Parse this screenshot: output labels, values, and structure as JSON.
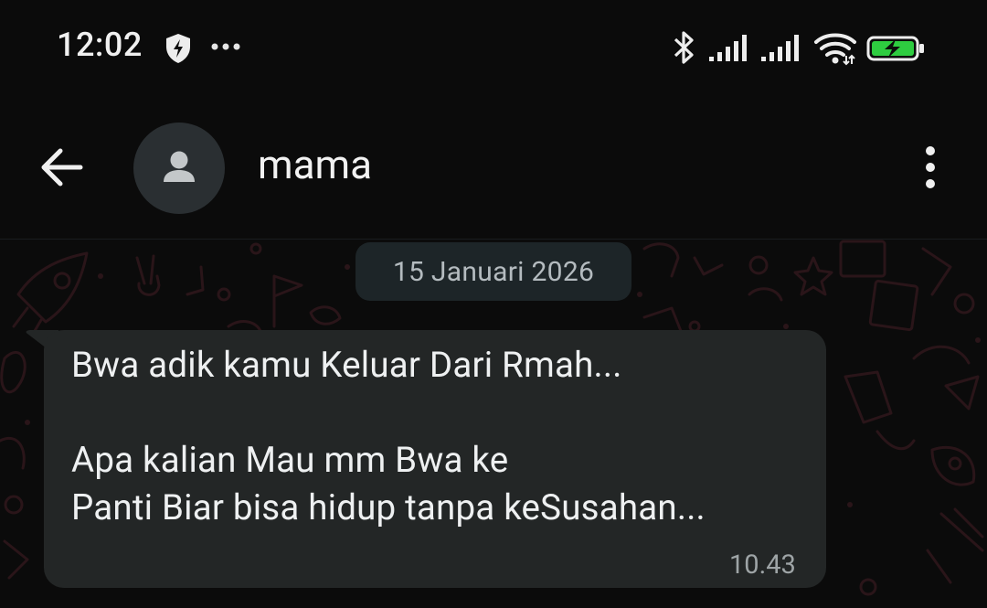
{
  "status_bar": {
    "time": "12:02",
    "icons": [
      "shield-bolt-icon",
      "more-dots-icon",
      "bluetooth-icon",
      "signal-icon",
      "signal-icon",
      "wifi-icon",
      "battery-charging-icon"
    ],
    "battery_color": "#2ecc40"
  },
  "header": {
    "contact_name": "mama",
    "back_icon": "arrow-left-icon",
    "avatar_icon": "person-icon",
    "menu_icon": "more-vertical-icon"
  },
  "chat": {
    "date_chip": "15 Januari 2026",
    "messages": [
      {
        "lines": [
          "Bwa adik kamu Keluar Dari Rmah...",
          "",
          "Apa kalian Mau mm Bwa ke",
          "Panti Biar bisa hidup tanpa keSusahan..."
        ],
        "time": "10.43",
        "direction": "incoming"
      }
    ]
  },
  "colors": {
    "background": "#0b0b0b",
    "bubble_incoming": "#232626",
    "date_chip_bg": "#1d2528",
    "wallpaper_doodle": "#2a1519"
  }
}
